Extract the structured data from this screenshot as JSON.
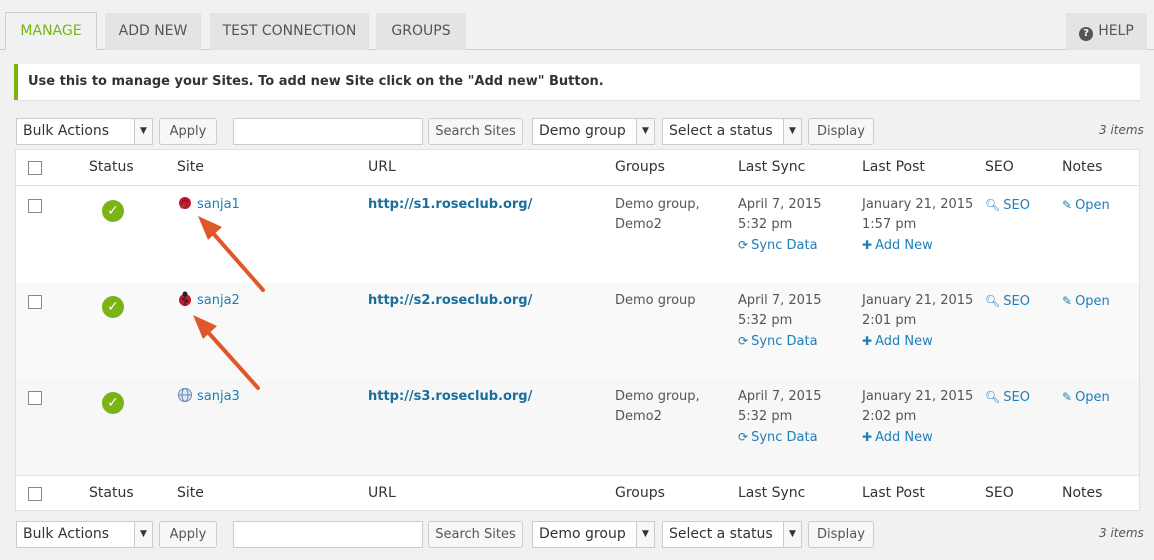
{
  "tabs": {
    "manage": "MANAGE",
    "add_new": "ADD NEW",
    "test_connection": "TEST CONNECTION",
    "groups": "GROUPS",
    "help": "HELP"
  },
  "notice": "Use this to manage your Sites. To add new Site click on the \"Add new\" Button.",
  "toolbar": {
    "bulk_actions": "Bulk Actions",
    "apply": "Apply",
    "search_value": "",
    "search_button": "Search Sites",
    "group_select": "Demo group",
    "status_select": "Select a status",
    "display": "Display",
    "items_count": "3 items"
  },
  "columns": {
    "status": "Status",
    "site": "Site",
    "url": "URL",
    "groups": "Groups",
    "last_sync": "Last Sync",
    "last_post": "Last Post",
    "seo": "SEO",
    "notes": "Notes"
  },
  "rows": [
    {
      "site": "sanja1",
      "icon": "rose-icon",
      "url": "http://s1.roseclub.org/",
      "groups_line1": "Demo group,",
      "groups_line2": "Demo2",
      "sync_date": "April 7, 2015",
      "sync_time": "5:32 pm",
      "sync_link": "Sync Data",
      "post_date": "January 21, 2015",
      "post_time": "1:57 pm",
      "post_link": "Add New",
      "seo": "SEO",
      "notes": "Open"
    },
    {
      "site": "sanja2",
      "icon": "ladybug-icon",
      "url": "http://s2.roseclub.org/",
      "groups_line1": "Demo group",
      "groups_line2": "",
      "sync_date": "April 7, 2015",
      "sync_time": "5:32 pm",
      "sync_link": "Sync Data",
      "post_date": "January 21, 2015",
      "post_time": "2:01 pm",
      "post_link": "Add New",
      "seo": "SEO",
      "notes": "Open"
    },
    {
      "site": "sanja3",
      "icon": "globe-icon",
      "url": "http://s3.roseclub.org/",
      "groups_line1": "Demo group,",
      "groups_line2": "Demo2",
      "sync_date": "April 7, 2015",
      "sync_time": "5:32 pm",
      "sync_link": "Sync Data",
      "post_date": "January 21, 2015",
      "post_time": "2:02 pm",
      "post_link": "Add New",
      "seo": "SEO",
      "notes": "Open"
    }
  ],
  "colors": {
    "accent": "#7ab317",
    "link": "#1e7eb5",
    "arrow": "#e0582a"
  }
}
